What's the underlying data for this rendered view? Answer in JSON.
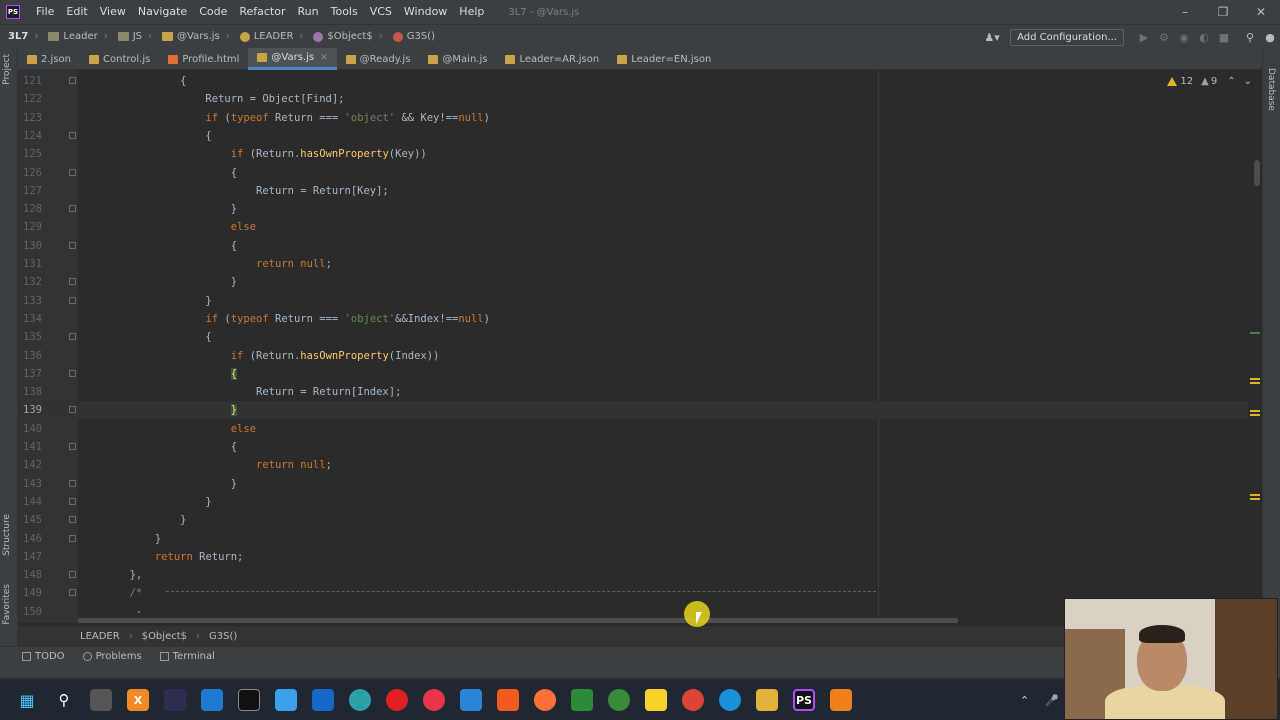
{
  "menu": {
    "items": [
      "File",
      "Edit",
      "View",
      "Navigate",
      "Code",
      "Refactor",
      "Run",
      "Tools",
      "VCS",
      "Window",
      "Help"
    ],
    "window_title": "3L7 - @Vars.js"
  },
  "nav": {
    "project": "3L7",
    "crumbs": [
      "Leader",
      "JS",
      "@Vars.js",
      "LEADER",
      "$Object$",
      "G3S()"
    ],
    "add_config": "Add Configuration..."
  },
  "tabs": [
    {
      "label": "2.json",
      "color": "#c7a548"
    },
    {
      "label": "Control.js",
      "color": "#c7a548"
    },
    {
      "label": "Profile.html",
      "color": "#e46e31"
    },
    {
      "label": "@Vars.js",
      "color": "#c7a548",
      "active": true
    },
    {
      "label": "@Ready.js",
      "color": "#c7a548"
    },
    {
      "label": "@Main.js",
      "color": "#c7a548"
    },
    {
      "label": "Leader=AR.json",
      "color": "#c7a548"
    },
    {
      "label": "Leader=EN.json",
      "color": "#c7a548"
    }
  ],
  "inspection": {
    "warnings": "12",
    "weak": "9"
  },
  "left_tools": [
    "Project",
    "Structure",
    "Favorites"
  ],
  "right_tools": [
    "Database"
  ],
  "line_numbers": [
    "121",
    "122",
    "123",
    "124",
    "125",
    "126",
    "127",
    "128",
    "129",
    "130",
    "131",
    "132",
    "133",
    "134",
    "135",
    "136",
    "137",
    "138",
    "139",
    "140",
    "141",
    "142",
    "143",
    "144",
    "145",
    "146",
    "147",
    "148",
    "149",
    "150"
  ],
  "code_lines": [
    "                {",
    "                    Return = Object[Find];",
    "                    if (typeof Return === 'object' && Key!==null)",
    "                    {",
    "                        if (Return.hasOwnProperty(Key))",
    "                        {",
    "                            Return = Return[Key];",
    "                        }",
    "                        else",
    "                        {",
    "                            return null;",
    "                        }",
    "                    }",
    "                    if (typeof Return === 'object'&&Index!==null)",
    "                    {",
    "                        if (Return.hasOwnProperty(Index))",
    "                        {",
    "                            Return = Return[Index];",
    "                        }",
    "                        else",
    "                        {",
    "                            return null;",
    "                        }",
    "                    }",
    "                }",
    "            }",
    "            return Return;",
    "        },",
    "        /* ",
    "         -"
  ],
  "bottom_crumbs": [
    "LEADER",
    "$Object$",
    "G3S()"
  ],
  "tool_windows": [
    "TODO",
    "Problems",
    "Terminal"
  ]
}
